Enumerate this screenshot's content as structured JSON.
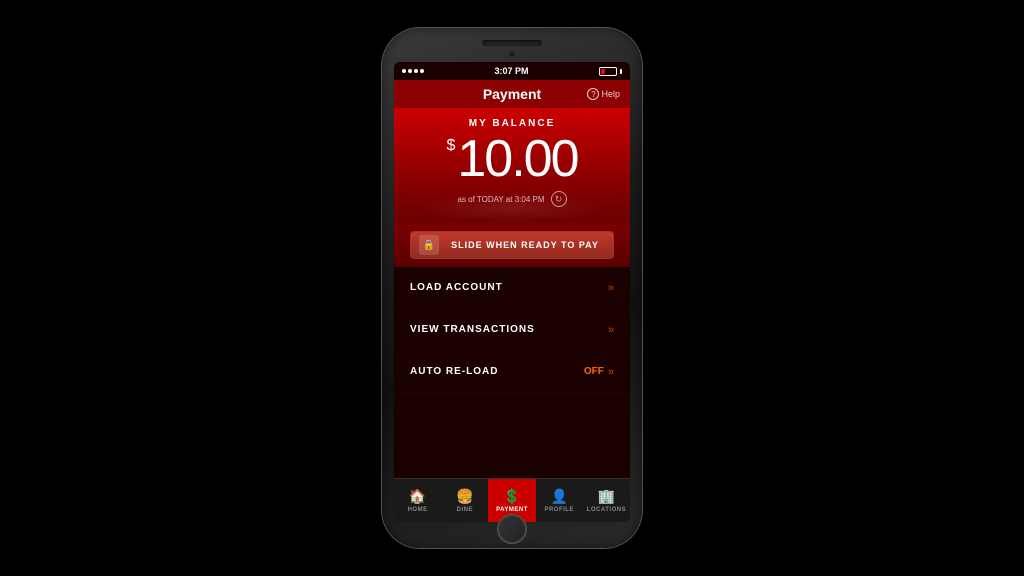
{
  "device": {
    "status_bar": {
      "dots": 4,
      "time": "3:07 PM",
      "battery_low": true
    }
  },
  "screen": {
    "nav": {
      "title": "Payment",
      "help_label": "Help"
    },
    "balance": {
      "section_label": "MY BALANCE",
      "currency_symbol": "$",
      "amount": "10.00",
      "timestamp": "as of TODAY at 3:04 PM"
    },
    "slide_button": {
      "label": "SLIDE WHEN READY TO PAY"
    },
    "menu_items": [
      {
        "label": "LOAD ACCOUNT",
        "value": null,
        "chevron": "»"
      },
      {
        "label": "VIEW TRANSACTIONS",
        "value": null,
        "chevron": "»"
      },
      {
        "label": "AUTO RE-LOAD",
        "value": "OFF",
        "chevron": "»"
      }
    ],
    "tab_bar": {
      "items": [
        {
          "label": "HOME",
          "icon": "🏠",
          "active": false
        },
        {
          "label": "DINE",
          "icon": "🍔",
          "active": false
        },
        {
          "label": "PAYMENT",
          "icon": "💲",
          "active": true
        },
        {
          "label": "PROFILE",
          "icon": "👤",
          "active": false
        },
        {
          "label": "LOCATIONS",
          "icon": "🏢",
          "active": false
        }
      ]
    }
  }
}
